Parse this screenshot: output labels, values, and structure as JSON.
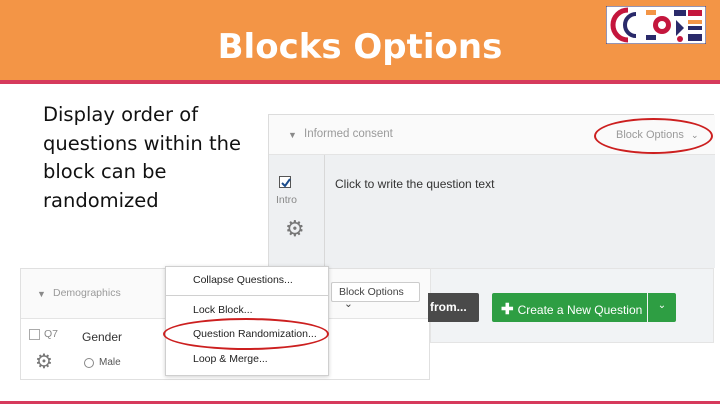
{
  "slide": {
    "title": "Blocks Options",
    "body": "Display order of questions within the block can be randomized"
  },
  "top_block": {
    "block_name": "Informed consent",
    "block_options_label": "Block Options",
    "question_text": "Click to write the question text",
    "question_label": "Intro",
    "question_checked": true
  },
  "bottom_block": {
    "block_name": "Demographics",
    "block_options_label": "Block Options",
    "question_id": "Q7",
    "question_text": "Gender",
    "choice": "Male"
  },
  "dropdown_menu": {
    "items": [
      "Collapse Questions...",
      "Lock Block...",
      "Question Randomization...",
      "Loop & Merge..."
    ]
  },
  "actions": {
    "import_from_label": "from...",
    "create_new_question_label": "Create a New Question"
  },
  "colors": {
    "header": "#f39546",
    "accent_line": "#d63a5c",
    "highlight_ellipse": "#cc1f1f",
    "create_button": "#2e9e43"
  },
  "icons": [
    "gear-icon",
    "chevron-down-icon",
    "plus-icon",
    "checkbox-icon",
    "logo"
  ]
}
